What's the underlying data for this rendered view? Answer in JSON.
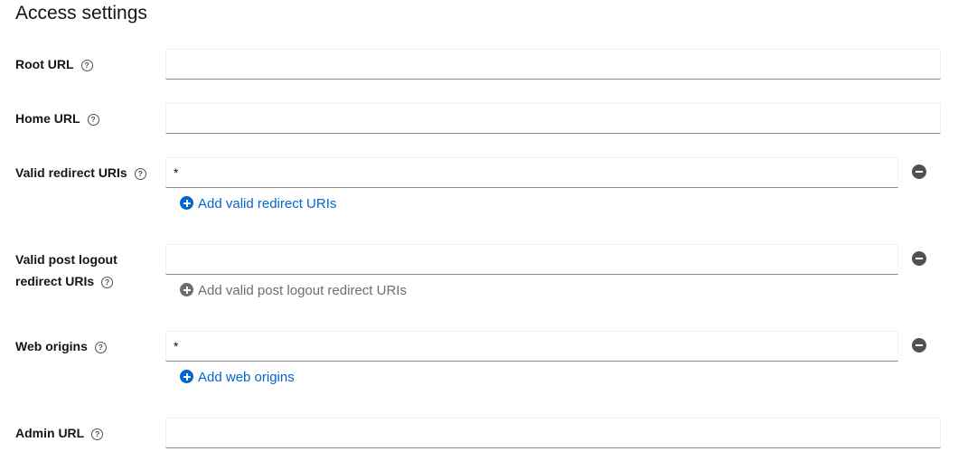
{
  "section": {
    "title": "Access settings"
  },
  "fields": {
    "root_url": {
      "label": "Root URL",
      "value": ""
    },
    "home_url": {
      "label": "Home URL",
      "value": ""
    },
    "valid_redirect_uris": {
      "label": "Valid redirect URIs",
      "value": "*",
      "add_label": "Add valid redirect URIs"
    },
    "valid_post_logout": {
      "label_line1": "Valid post logout",
      "label_line2": "redirect URIs",
      "value": "",
      "add_label": "Add valid post logout redirect URIs"
    },
    "web_origins": {
      "label": "Web origins",
      "value": "*",
      "add_label": "Add web origins"
    },
    "admin_url": {
      "label": "Admin URL",
      "value": ""
    }
  },
  "icons": {
    "help": "question-circle-icon",
    "remove": "minus-circle-icon",
    "add": "plus-circle-icon"
  },
  "colors": {
    "link": "#0066cc",
    "disabled": "#6a6e73",
    "text": "#151515",
    "icon_dark": "#4f5255"
  }
}
